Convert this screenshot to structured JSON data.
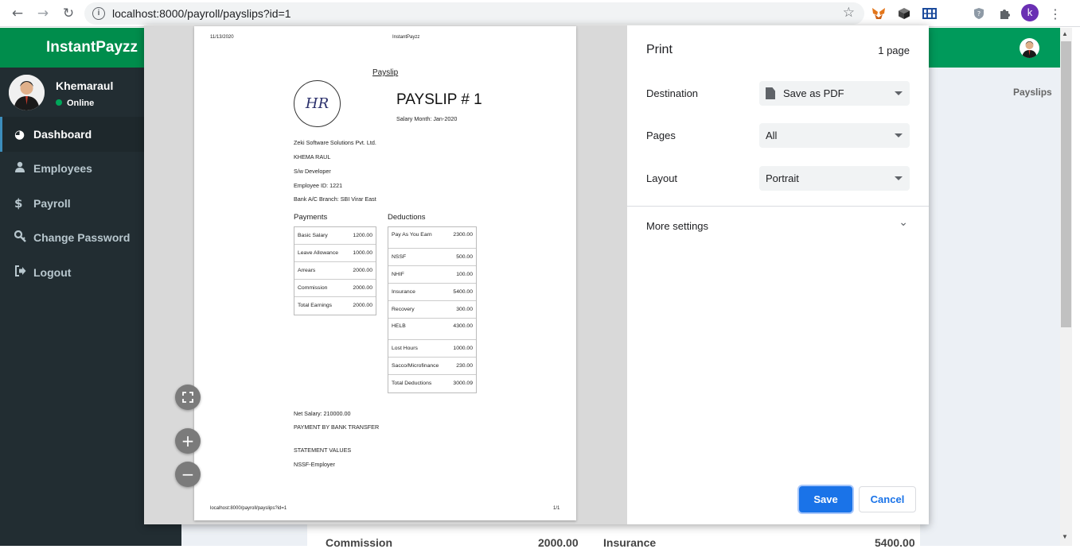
{
  "browser": {
    "url": "localhost:8000/payroll/payslips?id=1",
    "profile_initial": "k"
  },
  "app": {
    "brand": "InstantPayzz",
    "user": {
      "name": "Khemaraul",
      "status": "Online"
    },
    "menu": [
      {
        "label": "Dashboard",
        "icon": "dashboard-icon"
      },
      {
        "label": "Employees",
        "icon": "user-icon"
      },
      {
        "label": "Payroll",
        "icon": "dollar-icon"
      },
      {
        "label": "Change Password",
        "icon": "key-icon"
      },
      {
        "label": "Logout",
        "icon": "logout-icon"
      }
    ],
    "breadcrumb": "Payslips",
    "partial_labels": [
      "Commission",
      "2000.00",
      "Insurance",
      "5400.00"
    ]
  },
  "print_dialog": {
    "title": "Print",
    "page_count": "1 page",
    "destination_label": "Destination",
    "destination_value": "Save as PDF",
    "pages_label": "Pages",
    "pages_value": "All",
    "layout_label": "Layout",
    "layout_value": "Portrait",
    "more_settings": "More settings",
    "save_label": "Save",
    "cancel_label": "Cancel"
  },
  "payslip": {
    "header_date": "11/13/2020",
    "header_title": "InstantPayzz",
    "heading": "Payslip",
    "logo_text": "HR",
    "title": "PAYSLIP # 1",
    "salary_month": "Salary Month: Jan-2020",
    "company": "Zeki Software Solutions Pvt. Ltd.",
    "employee_name": "KHEMA RAUL",
    "designation": "S/w Developer",
    "employee_id": "Employee ID: 1221",
    "bank_branch": "Bank A/C Branch: SBI Virar East",
    "payments_heading": "Payments",
    "deductions_heading": "Deductions",
    "payments": [
      {
        "label": "Basic Salary",
        "value": "1200.00"
      },
      {
        "label": "Leave Allowance",
        "value": "1000.00"
      },
      {
        "label": "Arrears",
        "value": "2000.00"
      },
      {
        "label": "Commission",
        "value": "2000.00"
      },
      {
        "label": "Total Earnings",
        "value": "2000.00"
      }
    ],
    "deductions": [
      {
        "label": "Pay As You Earn",
        "value": "2300.00"
      },
      {
        "label": "NSSF",
        "value": "500.00"
      },
      {
        "label": "NHIF",
        "value": "100.00"
      },
      {
        "label": "Insurance",
        "value": "5400.00"
      },
      {
        "label": "Recovery",
        "value": "300.00"
      },
      {
        "label": "HELB",
        "value": "4300.00"
      },
      {
        "label": "Lost Hours",
        "value": "1000.00"
      },
      {
        "label": "Sacco/Microfinance",
        "value": "230.00"
      },
      {
        "label": "Total Deductions",
        "value": "3000.09"
      }
    ],
    "net_salary": "Net Salary: 210000.00",
    "payment_method": "PAYMENT BY BANK TRANSFER",
    "statement_values": "STATEMENT VALUES",
    "nssf_employer": "NSSF-Employer",
    "footer_url": "localhost:8000/payroll/payslips?id=1",
    "footer_page": "1/1"
  }
}
